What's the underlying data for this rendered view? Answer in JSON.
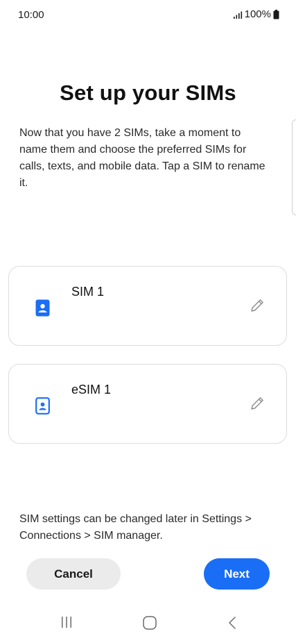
{
  "status_bar": {
    "time": "10:00",
    "battery": "100%",
    "signal_icon": "signal-bars-icon",
    "battery_icon": "battery-full-icon"
  },
  "page": {
    "title": "Set up your SIMs",
    "description": "Now that you have 2 SIMs, take a moment to name them and choose the preferred SIMs for calls, texts, and mobile data. Tap a SIM to rename it."
  },
  "sims": [
    {
      "name": "SIM 1",
      "icon": "sim-card-filled-icon",
      "edit_icon": "pencil-icon"
    },
    {
      "name": "eSIM 1",
      "icon": "esim-card-outline-icon",
      "edit_icon": "pencil-icon"
    }
  ],
  "footer": {
    "note": "SIM settings can be changed later in Settings > Connections > SIM manager."
  },
  "buttons": {
    "cancel": "Cancel",
    "next": "Next"
  },
  "colors": {
    "accent": "#1a6ef5",
    "cancel_bg": "#ebebeb",
    "card_border": "#dcdcdc"
  },
  "nav_bar": {
    "recents_icon": "recents-icon",
    "home_icon": "home-icon",
    "back_icon": "back-icon"
  }
}
